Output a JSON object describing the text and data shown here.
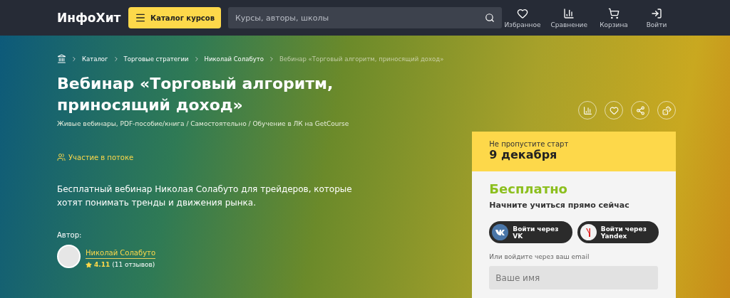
{
  "header": {
    "logo": "ИнфоХит",
    "catalog_button": "Каталог курсов",
    "search": {
      "placeholder": "Курсы, авторы, школы"
    },
    "nav": [
      {
        "kind": "favorites",
        "label": "Избранное"
      },
      {
        "kind": "compare",
        "label": "Сравнение"
      },
      {
        "kind": "cart",
        "label": "Корзина"
      },
      {
        "kind": "login",
        "label": "Войти"
      }
    ]
  },
  "breadcrumbs": [
    {
      "label": "Каталог",
      "current": false
    },
    {
      "label": "Торговые стратегии",
      "current": false
    },
    {
      "label": "Николай Солабуто",
      "current": false
    },
    {
      "label": "Вебинар «Торговый алгоритм, приносящий доход»",
      "current": true
    }
  ],
  "title": "Вебинар «Торговый алгоритм, приносящий доход»",
  "subtitle": "Живые вебинары, PDF-пособие/книга / Самостоятельно / Обучение в ЛК на GetCourse",
  "participation": "Участие в потоке",
  "description": "Бесплатный вебинар Николая Солабуто для трейдеров, которые хотят понимать тренды и движения рынка.",
  "author": {
    "label": "Автор:",
    "name": "Николай Солабуто",
    "rating": "4.11",
    "reviews": "(11 отзывов)"
  },
  "actions": [
    {
      "kind": "compare"
    },
    {
      "kind": "favorite"
    },
    {
      "kind": "share"
    },
    {
      "kind": "random"
    }
  ],
  "card": {
    "caption": "Не пропустите старт",
    "date": "9 декабря",
    "price": "Бесплатно",
    "tagline": "Начните учиться прямо сейчас",
    "login_buttons": [
      {
        "kind": "vk",
        "label": "Войти через VK"
      },
      {
        "kind": "yandex",
        "label": "Войти через Yandex"
      }
    ],
    "email_hint": "Или войдите через ваш email",
    "name_placeholder": "Ваше имя"
  }
}
